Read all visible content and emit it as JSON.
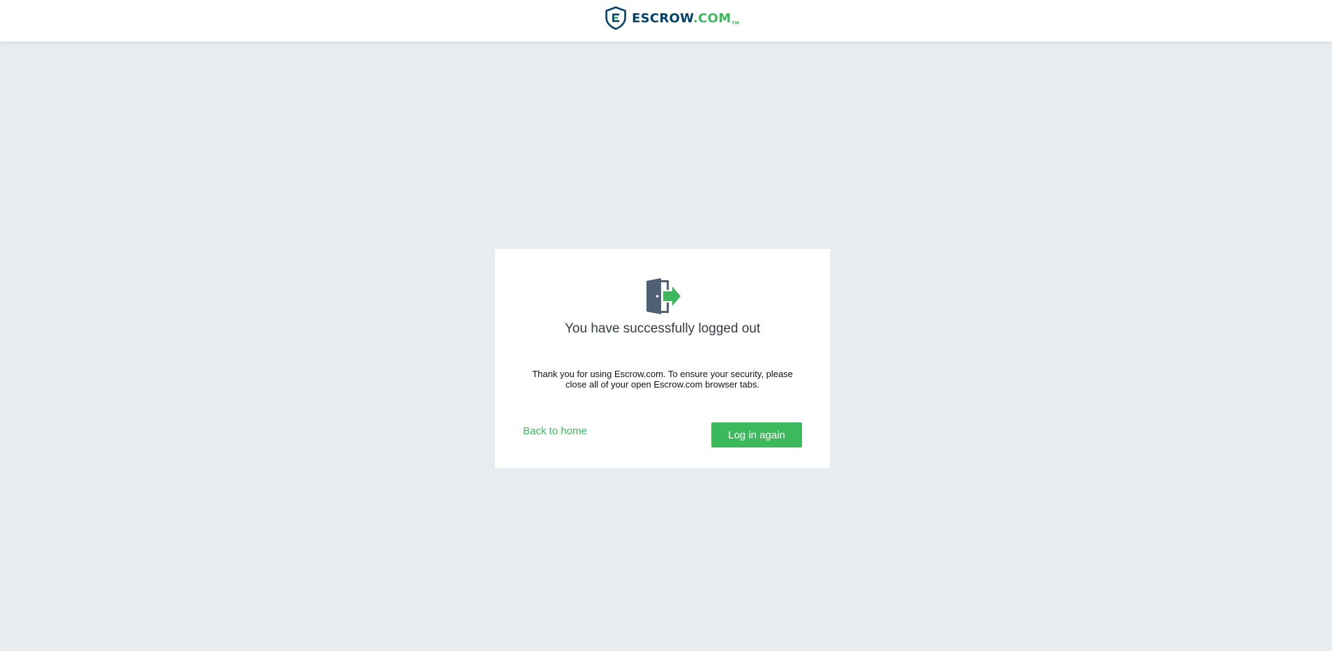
{
  "header": {
    "logo": {
      "icon": "escrow-shield-logo-icon",
      "name": "ESCROW",
      "tld": ".COM",
      "tm": "TM"
    }
  },
  "card": {
    "icon": "logout-door-icon",
    "title": "You have successfully logged out",
    "message": "Thank you for using Escrow.com. To ensure your security, please close all of your open Escrow.com browser tabs.",
    "back_link": "Back to home",
    "login_button": "Log in again"
  },
  "colors": {
    "page_background": "#e7ecf0",
    "brand_green": "#3cb95d",
    "brand_navy": "#01426a",
    "door_slate": "#4f6074"
  }
}
